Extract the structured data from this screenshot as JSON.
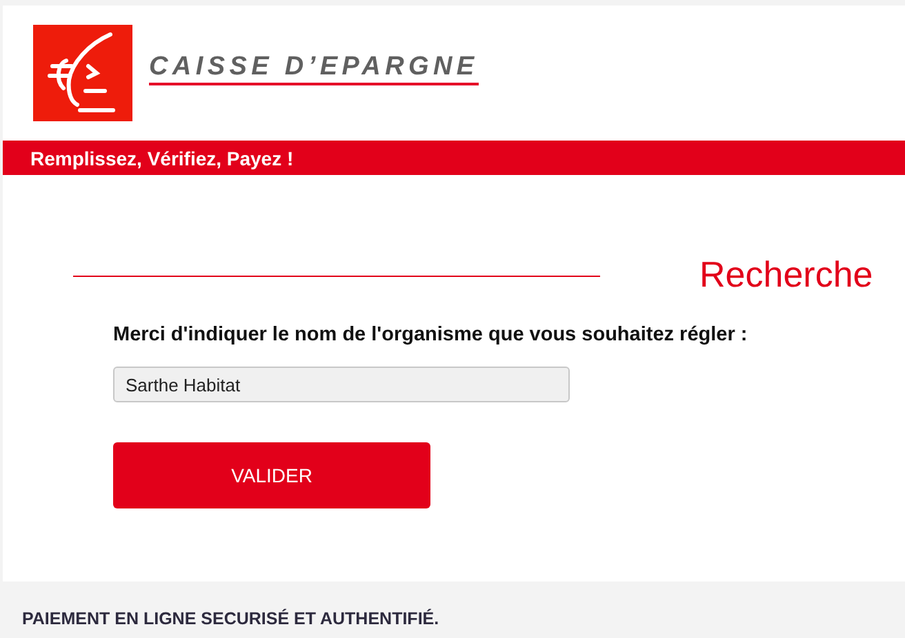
{
  "logo": {
    "name": "CAISSE D’EPARGNE"
  },
  "banner": {
    "text": "Remplissez, Vérifiez, Payez !"
  },
  "section": {
    "title": "Recherche"
  },
  "form": {
    "label": "Merci d'indiquer le nom de l'organisme que vous souhaitez régler :",
    "value": "Sarthe Habitat",
    "button": "VALIDER"
  },
  "footer": {
    "text": "PAIEMENT EN LIGNE SECURISÉ ET AUTHENTIFIÉ."
  }
}
